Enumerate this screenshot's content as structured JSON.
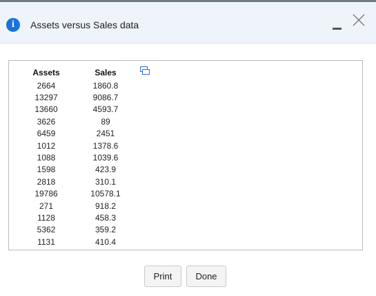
{
  "dialog": {
    "title": "Assets versus Sales data"
  },
  "icons": {
    "info": "info-icon",
    "minimize": "minimize-icon",
    "close": "close-icon",
    "popout": "popout-icon"
  },
  "table": {
    "headers": [
      "Assets",
      "Sales"
    ],
    "rows": [
      [
        "2664",
        "1860.8"
      ],
      [
        "13297",
        "9086.7"
      ],
      [
        "13660",
        "4593.7"
      ],
      [
        "3626",
        "89"
      ],
      [
        "6459",
        "2451"
      ],
      [
        "1012",
        "1378.6"
      ],
      [
        "1088",
        "1039.6"
      ],
      [
        "1598",
        "423.9"
      ],
      [
        "2818",
        "310.1"
      ],
      [
        "19786",
        "10578.1"
      ],
      [
        "271",
        "918.2"
      ],
      [
        "1128",
        "458.3"
      ],
      [
        "5362",
        "359.2"
      ],
      [
        "1131",
        "410.4"
      ]
    ]
  },
  "buttons": {
    "print": "Print",
    "done": "Done"
  },
  "colors": {
    "header_bg": "#eef4fa",
    "info_icon": "#1a73d9",
    "popout_icon": "#2a6fd0"
  }
}
